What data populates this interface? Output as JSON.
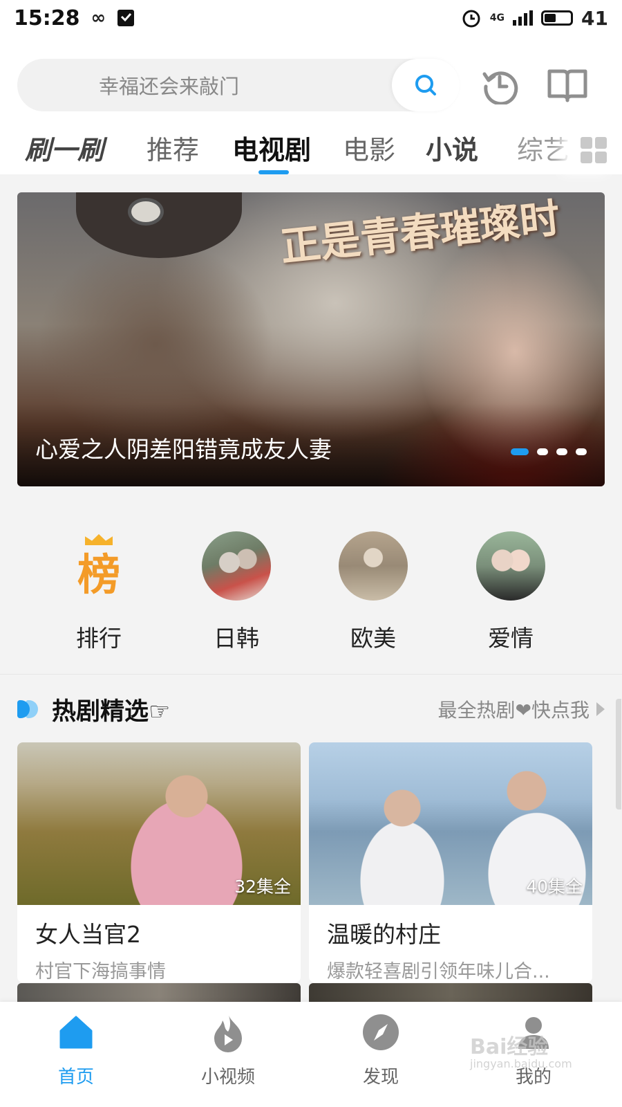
{
  "status_bar": {
    "time": "15:28",
    "network": "4G",
    "battery": "41"
  },
  "search": {
    "placeholder": "幸福还会来敲门"
  },
  "tabs": [
    {
      "label": "刷一刷"
    },
    {
      "label": "推荐"
    },
    {
      "label": "电视剧",
      "active": true
    },
    {
      "label": "电影"
    },
    {
      "label": "小说"
    },
    {
      "label": "综艺"
    }
  ],
  "banner": {
    "caption": "心爱之人阴差阳错竟成友人妻",
    "calligraphy": "正是青春璀璨时",
    "slide_count": 4,
    "active_slide": 1
  },
  "categories": [
    {
      "label": "排行",
      "icon": "rank-icon",
      "glyph": "榜"
    },
    {
      "label": "日韩",
      "icon": "japan-korea-thumbnail"
    },
    {
      "label": "欧美",
      "icon": "western-thumbnail"
    },
    {
      "label": "爱情",
      "icon": "romance-thumbnail"
    }
  ],
  "section": {
    "title": "热剧精选☞",
    "more": "最全热剧❤快点我"
  },
  "cards": [
    {
      "title": "女人当官2",
      "desc": "村官下海搞事情",
      "badge": "32集全"
    },
    {
      "title": "温暖的村庄",
      "desc": "爆款轻喜剧引领年味儿合...",
      "badge": "40集全"
    }
  ],
  "bottom_nav": [
    {
      "label": "首页",
      "icon": "home-icon",
      "active": true
    },
    {
      "label": "小视频",
      "icon": "flame-icon"
    },
    {
      "label": "发现",
      "icon": "compass-icon"
    },
    {
      "label": "我的",
      "icon": "profile-icon"
    }
  ],
  "watermark": {
    "main": "Bai经验",
    "sub": "jingyan.baidu.com"
  },
  "colors": {
    "accent": "#1e9cf0",
    "rank_orange": "#f39b28"
  }
}
